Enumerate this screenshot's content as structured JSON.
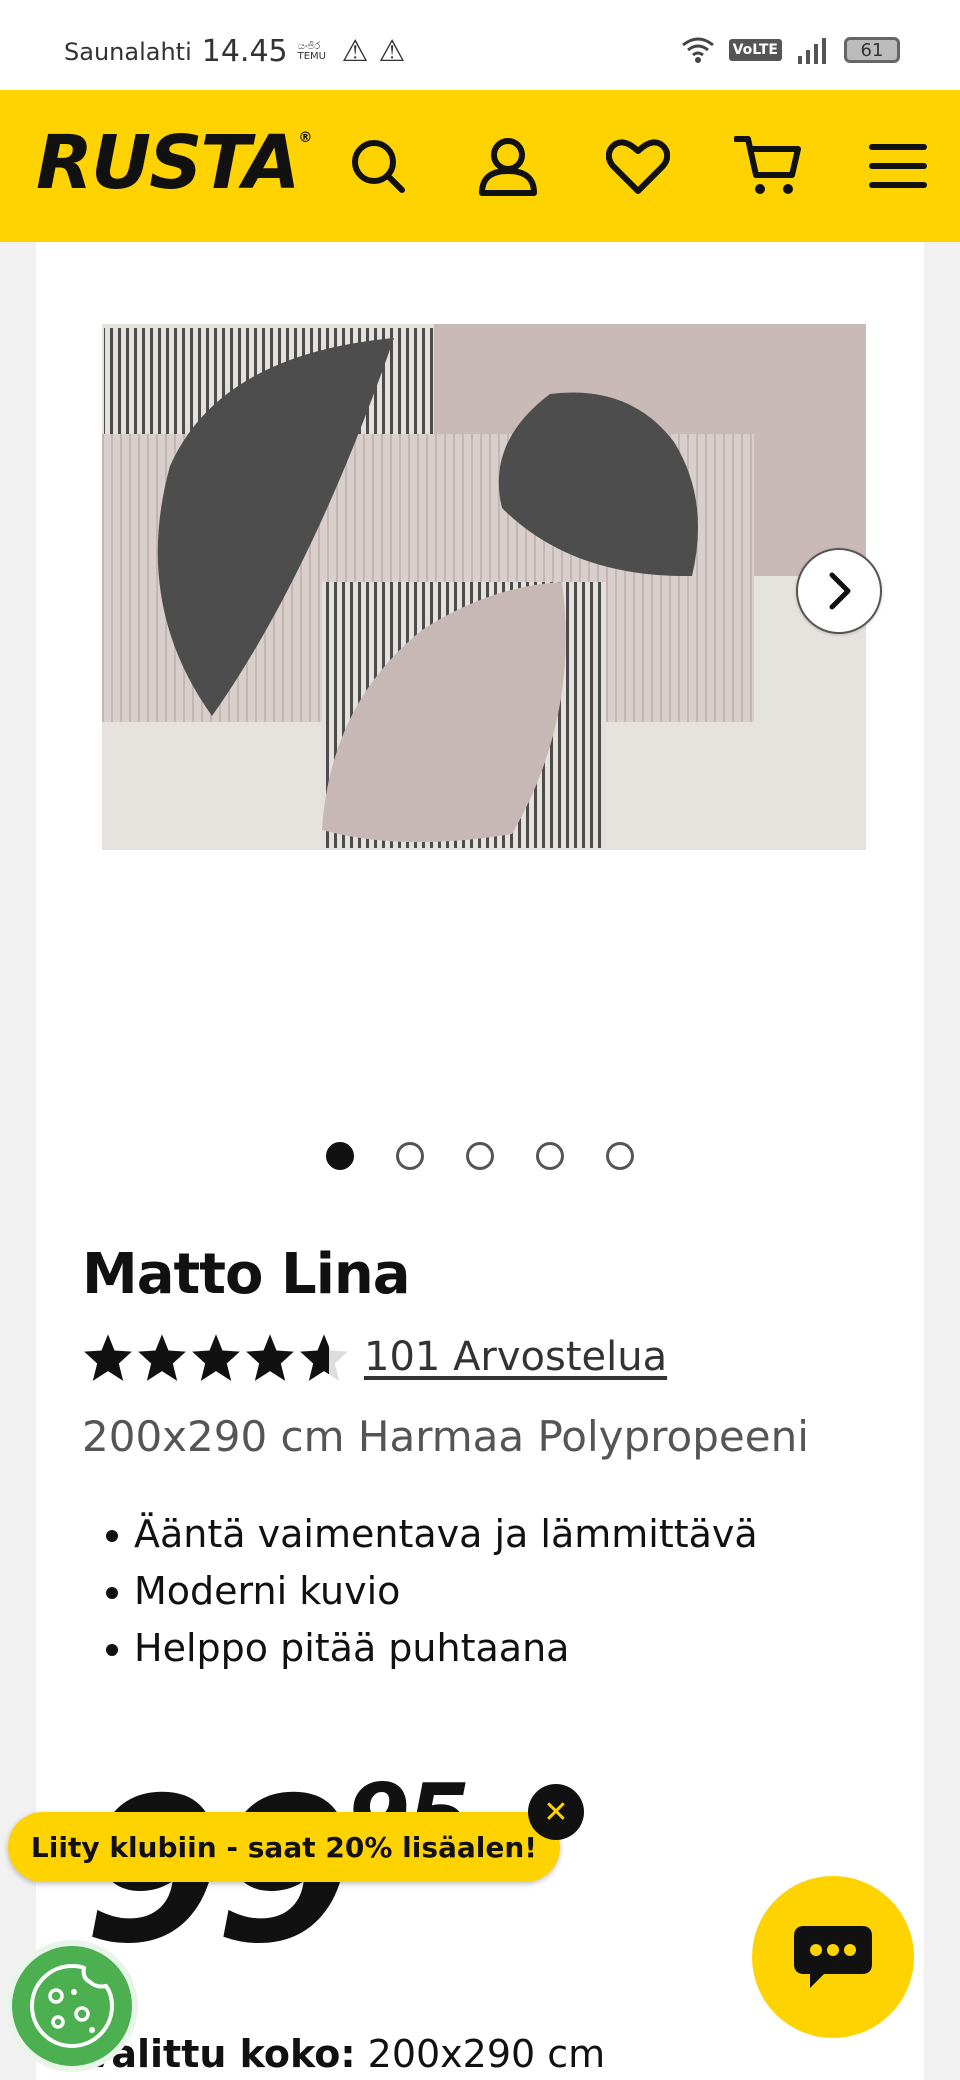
{
  "status_bar": {
    "carrier": "Saunalahti",
    "time": "14.45",
    "mini_label_1": "යංජිර",
    "mini_label_2": "TEMU",
    "network_badge": "VoLTE",
    "battery": "61"
  },
  "header": {
    "logo": "RUSTA",
    "logo_mark": "®",
    "icons": [
      "search-icon",
      "account-icon",
      "wishlist-heart-icon",
      "cart-icon",
      "menu-icon"
    ],
    "brand_color": "#ffd300"
  },
  "gallery": {
    "image_count": 5,
    "active_index": 0
  },
  "product": {
    "title": "Matto Lina",
    "rating_out_of_5": 4.6,
    "reviews_link": "101 Arvostelua",
    "subtitle": "200x290 cm Harmaa Polypropeeni",
    "features": [
      "Ääntä vaimentava ja lämmittävä",
      "Moderni kuvio",
      "Helppo pitää puhtaana"
    ],
    "price": "99",
    "price_cents": "95",
    "selected_size_label": "Valittu koko:",
    "selected_size_value": "200x290 cm"
  },
  "promo": {
    "club_banner": "Liity klubiin - saat 20% lisäalen!",
    "close_label": "✕"
  }
}
